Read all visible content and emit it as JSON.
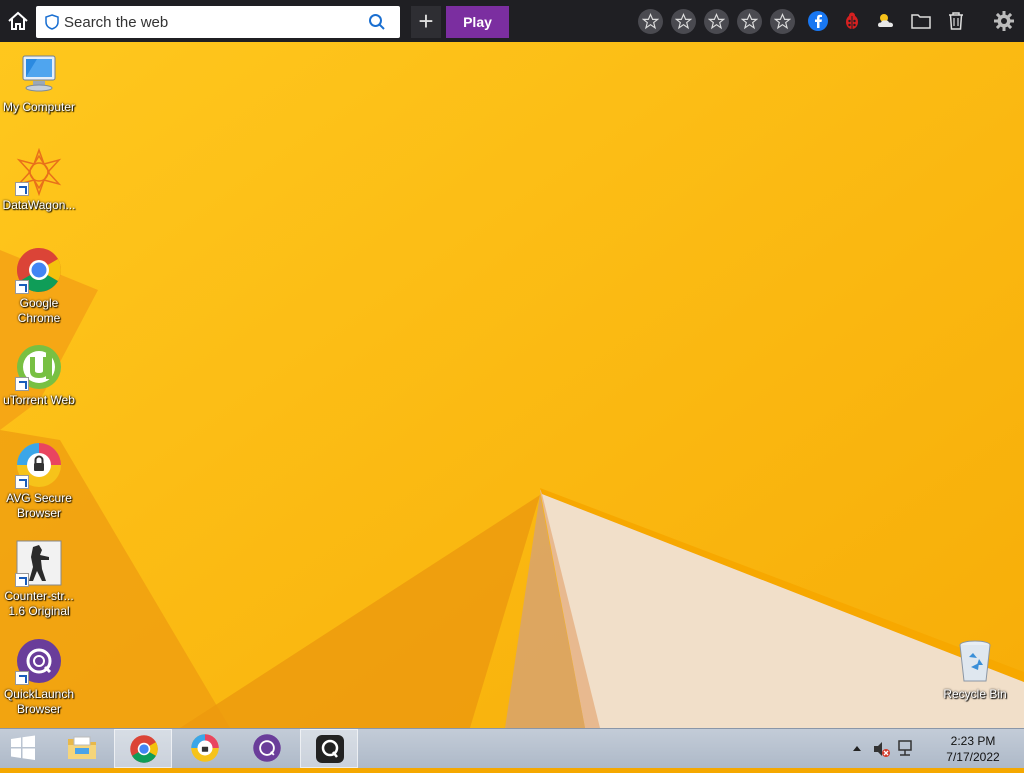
{
  "toolbar": {
    "search_placeholder": "Search the web",
    "play_label": "Play",
    "add_label": "+",
    "favorites": [
      "star-1",
      "star-2",
      "star-3",
      "star-4",
      "star-5"
    ],
    "right_icons": [
      "facebook-icon",
      "bug-icon",
      "weather-icon",
      "folder-icon",
      "trash-icon",
      "gear-icon"
    ],
    "accent": "#7b2ea0",
    "bg": "#1f1f23"
  },
  "desktop": {
    "icons": [
      {
        "label": "My Computer",
        "icon": "computer-icon"
      },
      {
        "label": "DataWagon...",
        "icon": "datawagon-icon"
      },
      {
        "label": "Google\nChrome",
        "icon": "chrome-icon"
      },
      {
        "label": "uTorrent Web",
        "icon": "utorrent-icon"
      },
      {
        "label": "AVG Secure\nBrowser",
        "icon": "avg-browser-icon"
      },
      {
        "label": "Counter-str...\n1.6 Original",
        "icon": "counter-strike-icon"
      },
      {
        "label": "QuickLaunch\nBrowser",
        "icon": "quicklaunch-icon"
      }
    ],
    "recycle_bin": {
      "label": "Recycle Bin",
      "icon": "recycle-bin-icon"
    }
  },
  "taskbar": {
    "items": [
      "start-button",
      "file-explorer",
      "chrome",
      "avg-browser",
      "quicklaunch",
      "q-app"
    ],
    "clock": {
      "time": "2:23 PM",
      "date": "7/17/2022"
    }
  }
}
